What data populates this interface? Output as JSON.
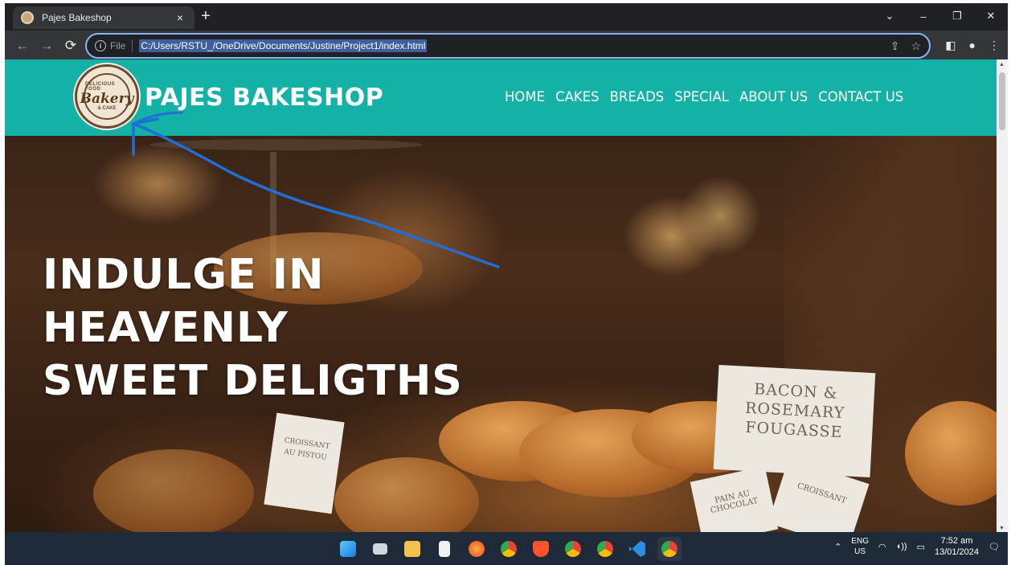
{
  "browser": {
    "tab_title": "Pajes Bakeshop",
    "tab_close": "×",
    "new_tab": "+",
    "file_label": "File",
    "url": "C:/Users/RSTU_/OneDrive/Documents/Justine/Project1/index.html"
  },
  "site": {
    "logo": {
      "top_text": "DELICIOUS FOOD",
      "main_text": "Bakery",
      "sub_text": "& CAKE"
    },
    "brand": "PAJES BAKESHOP",
    "nav": [
      "HOME",
      "CAKES",
      "BREADS",
      "SPECIAL",
      "ABOUT US",
      "CONTACT US"
    ]
  },
  "hero": {
    "title_lines": [
      "INDULGE IN",
      "HEAVENLY",
      "SWEET DELIGTHS"
    ],
    "signs": {
      "big": [
        "BACON &",
        "ROSEMARY",
        "FOUGASSE"
      ],
      "small1": [
        "CROISSANT",
        "AU PISTOU"
      ],
      "small2": [
        "PAIN AU",
        "CHOCOLAT"
      ],
      "small3": [
        "CROISSANT"
      ]
    }
  },
  "taskbar": {
    "lang_top": "ENG",
    "lang_bottom": "US",
    "time": "7:52 am",
    "date": "13/01/2024"
  },
  "colors": {
    "header_bg": "#14b1a6",
    "annotation_stroke": "#1f6fd6"
  }
}
